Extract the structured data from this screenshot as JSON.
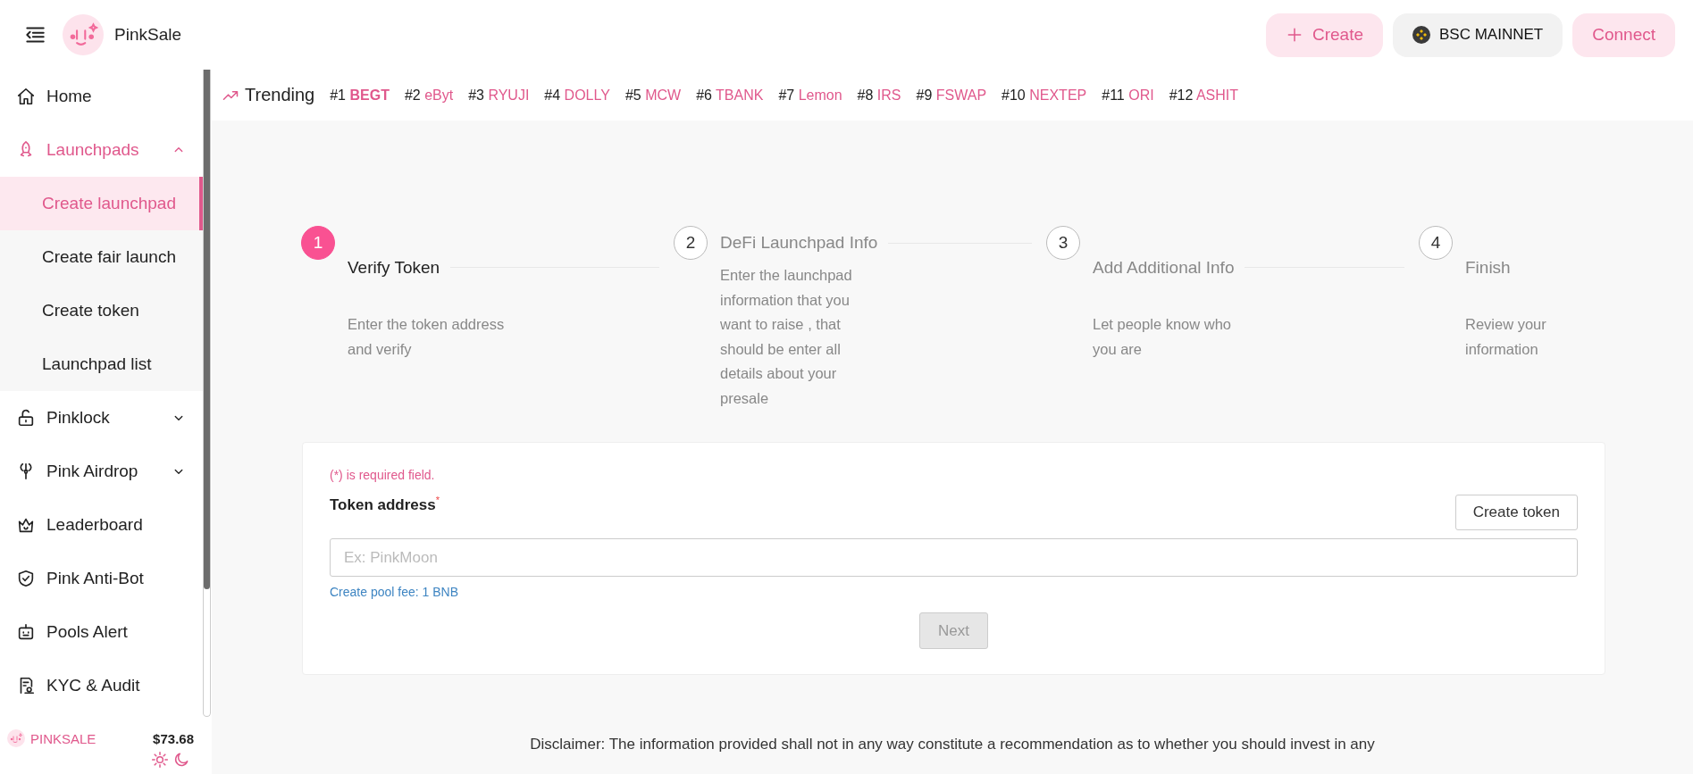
{
  "header": {
    "brand": "PinkSale",
    "buttons": [
      {
        "kind": "create",
        "label": "Create"
      },
      {
        "kind": "network",
        "label": "BSC MAINNET"
      },
      {
        "kind": "connect",
        "label": "Connect"
      }
    ]
  },
  "sidebar": {
    "items": [
      {
        "label": "Home",
        "selected": false
      },
      {
        "label": "Launchpads",
        "selected": true,
        "expanded": true,
        "children": [
          {
            "label": "Create launchpad",
            "selected": true
          },
          {
            "label": "Create fair launch",
            "selected": false
          },
          {
            "label": "Create token",
            "selected": false
          },
          {
            "label": "Launchpad list",
            "selected": false
          }
        ]
      },
      {
        "label": "Pinklock",
        "selected": false,
        "expanded": false
      },
      {
        "label": "Pink Airdrop",
        "selected": false,
        "expanded": false
      },
      {
        "label": "Leaderboard",
        "selected": false
      },
      {
        "label": "Pink Anti-Bot",
        "selected": false
      },
      {
        "label": "Pools Alert",
        "selected": false
      },
      {
        "label": "KYC & Audit",
        "selected": false
      }
    ],
    "footer": {
      "brand": "PINKSALE",
      "price": "$73.68"
    }
  },
  "trending": {
    "title": "Trending",
    "items": [
      {
        "rank": "#1",
        "symbol": "BEGT"
      },
      {
        "rank": "#2",
        "symbol": "eByt"
      },
      {
        "rank": "#3",
        "symbol": "RYUJI"
      },
      {
        "rank": "#4",
        "symbol": "DOLLY"
      },
      {
        "rank": "#5",
        "symbol": "MCW"
      },
      {
        "rank": "#6",
        "symbol": "TBANK"
      },
      {
        "rank": "#7",
        "symbol": "Lemon"
      },
      {
        "rank": "#8",
        "symbol": "IRS"
      },
      {
        "rank": "#9",
        "symbol": "FSWAP"
      },
      {
        "rank": "#10",
        "symbol": "NEXTEP"
      },
      {
        "rank": "#11",
        "symbol": "ORI"
      },
      {
        "rank": "#12",
        "symbol": "ASHIT"
      }
    ]
  },
  "steps": [
    {
      "number": "1",
      "title": "Verify Token",
      "description": "Enter the token address and verify",
      "selected": true
    },
    {
      "number": "2",
      "title": "DeFi Launchpad Info",
      "description": "Enter the launchpad information that you want to raise , that should be enter all details about your presale",
      "selected": false
    },
    {
      "number": "3",
      "title": "Add Additional Info",
      "description": "Let people know who you are",
      "selected": false
    },
    {
      "number": "4",
      "title": "Finish",
      "description": "Review your information",
      "selected": false
    }
  ],
  "form": {
    "required_note": "(*) is required field.",
    "label": "Token address",
    "required_mark": "*",
    "create_token_button": "Create token",
    "input": {
      "placeholder": "Ex: PinkMoon"
    },
    "fee_note": "Create pool fee: 1 BNB",
    "next_button": {
      "label": "Next",
      "disabled": true
    }
  },
  "disclaimer": "Disclaimer: The information provided shall not in any way constitute a recommendation as to whether you should invest in any"
}
